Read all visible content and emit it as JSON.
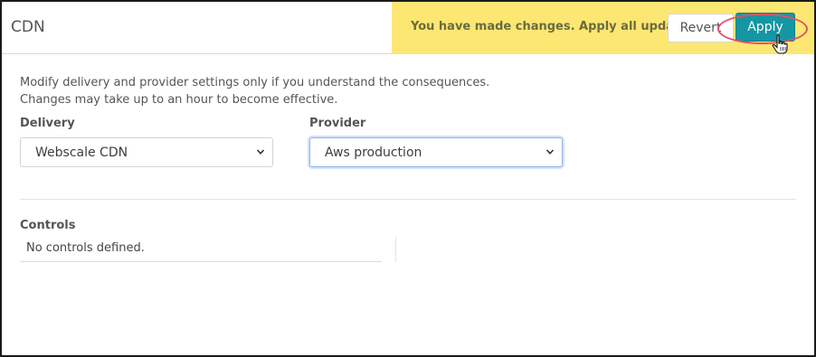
{
  "page": {
    "title": "CDN"
  },
  "banner": {
    "message": "You have made changes. Apply all updates?",
    "revert_label": "Revert",
    "apply_label": "Apply",
    "color": "#fce772",
    "apply_color": "#1596a3"
  },
  "notice": {
    "line1": "Modify delivery and provider settings only if you understand the consequences.",
    "line2": "Changes may take up to an hour to become effective."
  },
  "delivery": {
    "label": "Delivery",
    "selected": "Webscale CDN",
    "icon": "chevron-down-icon"
  },
  "provider": {
    "label": "Provider",
    "selected": "Aws production",
    "icon": "chevron-down-icon"
  },
  "controls": {
    "title": "Controls",
    "empty_text": "No controls defined."
  }
}
